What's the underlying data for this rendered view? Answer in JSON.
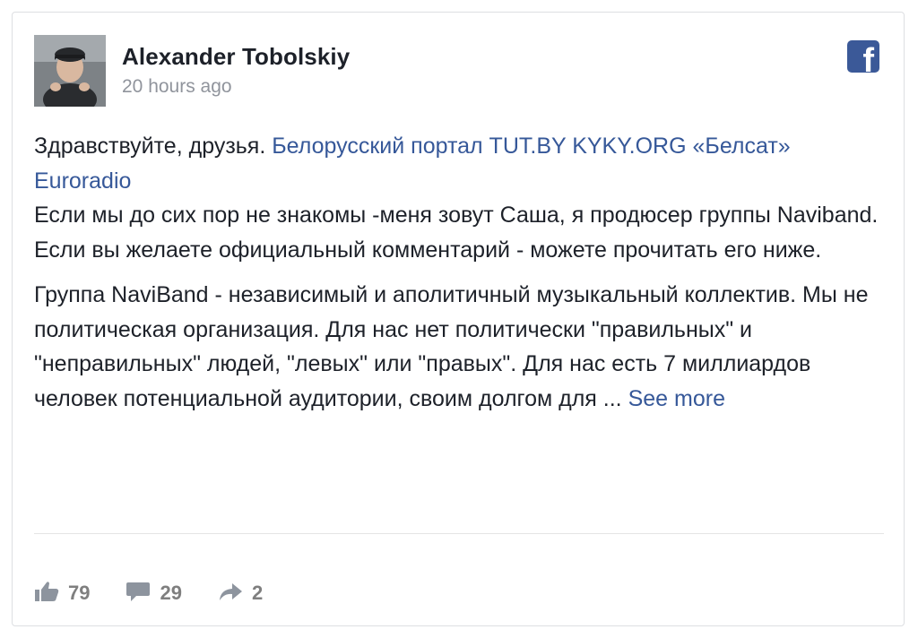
{
  "post": {
    "author": "Alexander Tobolskiy",
    "time": "20 hours ago",
    "greeting": "Здравствуйте, друзья.",
    "tags": [
      "Белорусский портал TUT.BY",
      "KYKY.ORG",
      "«Белсат»",
      "Euroradio"
    ],
    "line2": "Если мы до сих пор не знакомы -меня зовут Саша, я продюсер группы Naviband.",
    "line3": "Если вы желаете официальный комментарий - можете прочитать его ниже.",
    "body": "Группа NaviBand - независимый и аполитичный музыкальный коллектив. Мы не политическая организация. Для нас нет политически \"правильных\" и \"неправильных\" людей, \"левых\" или \"правых\". Для нас есть 7 миллиардов человек потенциальной аудитории, своим долгом для ...",
    "see_more": "See more"
  },
  "actions": {
    "likes": "79",
    "comments": "29",
    "shares": "2"
  },
  "icons": {
    "brand": "facebook-icon",
    "like": "thumbs-up-icon",
    "comment": "comment-icon",
    "share": "share-arrow-icon"
  },
  "colors": {
    "link": "#365899",
    "facebook": "#3b5998",
    "text": "#1d2129",
    "muted": "#90949c"
  }
}
